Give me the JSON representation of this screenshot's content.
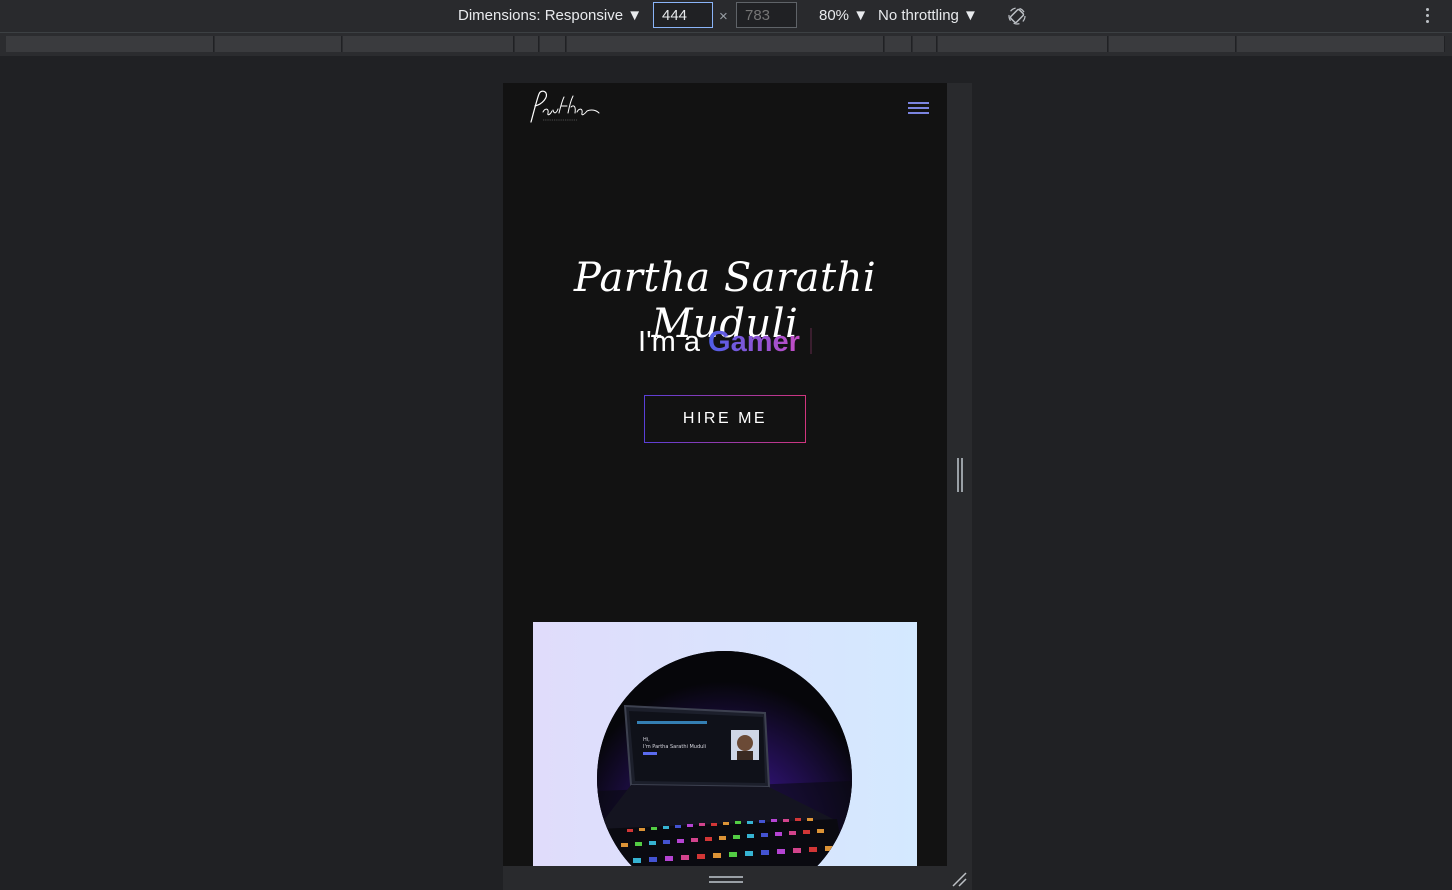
{
  "devtools": {
    "dimensions_label": "Dimensions: Responsive ▼",
    "width_value": "444",
    "times": "×",
    "height_placeholder": "783",
    "zoom": "80% ▼",
    "throttling": "No throttling ▼",
    "icons": [
      "rotate-icon",
      "more-vert-icon"
    ]
  },
  "site": {
    "logo_text": "Partha",
    "name": "Partha Sarathi Muduli",
    "role_prefix": "I'm a ",
    "role_highlight": "Gamer",
    "hire_label": "HIRE ME",
    "accent_colors": [
      "#4f5fe8",
      "#c44cc4",
      "#d0357e"
    ],
    "background": "#121212",
    "card_gradient": [
      "#e0dcfb",
      "#d4e9ff"
    ]
  }
}
